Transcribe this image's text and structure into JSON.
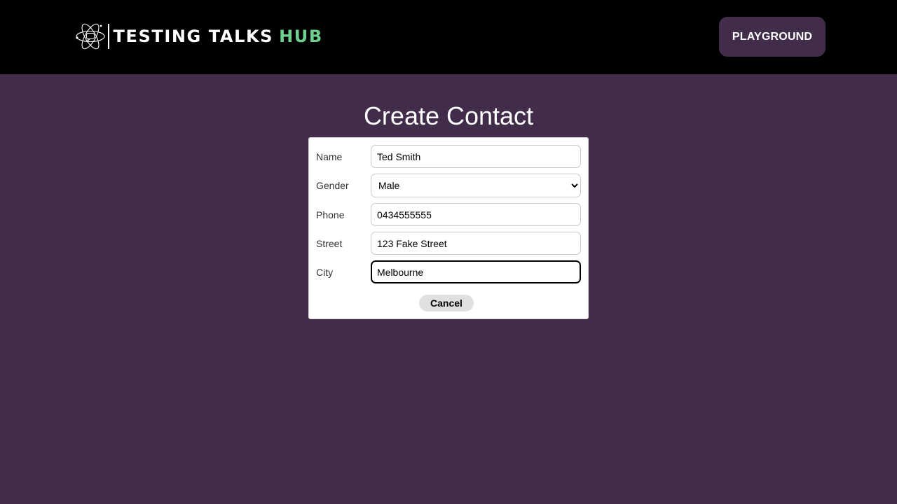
{
  "brand": {
    "name": "TESTING TALKS",
    "highlight": "HUB",
    "accent": "#6fcf8e",
    "icon": "atom-chat-icon"
  },
  "nav": {
    "playground_label": "PLAYGROUND"
  },
  "page": {
    "title": "Create Contact"
  },
  "form": {
    "name": {
      "label": "Name",
      "value": "Ted Smith"
    },
    "gender": {
      "label": "Gender",
      "value": "Male",
      "options": [
        "Male"
      ]
    },
    "phone": {
      "label": "Phone",
      "value": "0434555555"
    },
    "street": {
      "label": "Street",
      "value": "123 Fake Street"
    },
    "city": {
      "label": "City",
      "value": "Melbourne"
    },
    "cancel_label": "Cancel"
  },
  "colors": {
    "background": "#412c4a",
    "header": "#000000",
    "button": "#412c4a"
  }
}
